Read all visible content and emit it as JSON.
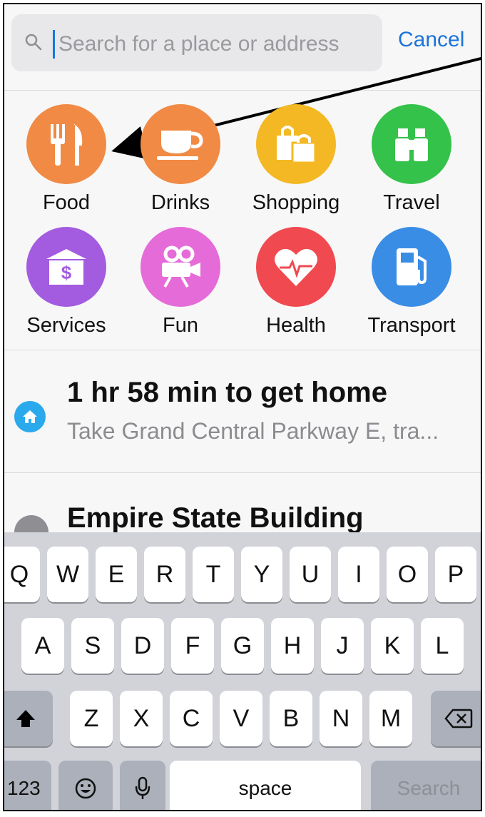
{
  "search": {
    "placeholder": "Search for a place or address",
    "cancel_label": "Cancel"
  },
  "categories": [
    {
      "label": "Food",
      "icon": "fork-knife-icon",
      "color": "#f08a44"
    },
    {
      "label": "Drinks",
      "icon": "coffee-cup-icon",
      "color": "#f08a44"
    },
    {
      "label": "Shopping",
      "icon": "shopping-bags-icon",
      "color": "#f3b823"
    },
    {
      "label": "Travel",
      "icon": "binoculars-icon",
      "color": "#34c24a"
    },
    {
      "label": "Services",
      "icon": "bank-icon",
      "color": "#a35be0"
    },
    {
      "label": "Fun",
      "icon": "film-camera-icon",
      "color": "#e56bd8"
    },
    {
      "label": "Health",
      "icon": "heart-pulse-icon",
      "color": "#f0494f"
    },
    {
      "label": "Transport",
      "icon": "fuel-pump-icon",
      "color": "#3a8de4"
    }
  ],
  "list": {
    "home": {
      "title": "1 hr 58 min to get home",
      "subtitle": "Take Grand Central Parkway E, tra..."
    },
    "place": {
      "title": "Empire State Building"
    }
  },
  "keyboard": {
    "row1": [
      "Q",
      "W",
      "E",
      "R",
      "T",
      "Y",
      "U",
      "I",
      "O",
      "P"
    ],
    "row2": [
      "A",
      "S",
      "D",
      "F",
      "G",
      "H",
      "J",
      "K",
      "L"
    ],
    "row3": [
      "Z",
      "X",
      "C",
      "V",
      "B",
      "N",
      "M"
    ],
    "numbers_label": "123",
    "space_label": "space",
    "search_label": "Search"
  }
}
